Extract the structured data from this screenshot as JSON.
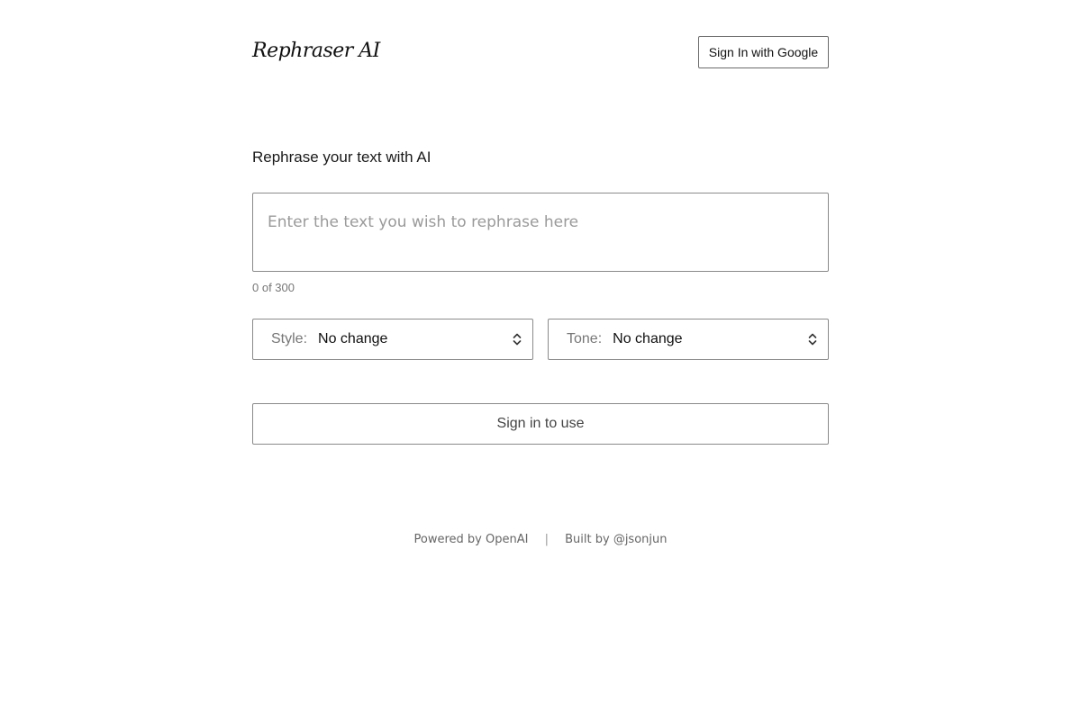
{
  "header": {
    "logo": "Rephraser AI",
    "signin_label": "Sign In with Google"
  },
  "main": {
    "heading": "Rephrase your text with AI",
    "input": {
      "value": "",
      "placeholder": "Enter the text you wish to rephrase here"
    },
    "counter": "0 of 300",
    "style_select": {
      "label": "Style:",
      "value": "No change",
      "icon": "chevron-up-down-icon"
    },
    "tone_select": {
      "label": "Tone:",
      "value": "No change",
      "icon": "chevron-up-down-icon"
    },
    "submit_label": "Sign in to use"
  },
  "footer": {
    "powered_by": "Powered by OpenAI",
    "separator": "|",
    "built_by": "Built by @jsonjun"
  }
}
